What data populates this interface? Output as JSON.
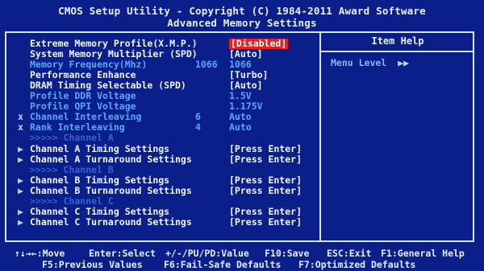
{
  "header": {
    "title": "CMOS Setup Utility - Copyright (C) 1984-2011 Award Software",
    "subtitle": "Advanced Memory Settings"
  },
  "help": {
    "title": "Item Help",
    "menu_level_label": "Menu Level",
    "menu_level_arrows": "▶▶"
  },
  "settings": [
    {
      "mark": "",
      "label": "Extreme Memory Profile(X.M.P.)",
      "num": "",
      "value": "[Disabled]",
      "style": "normal",
      "selected": true
    },
    {
      "mark": "",
      "label": "System Memory Multiplier (SPD)",
      "num": "",
      "value": "[Auto]",
      "style": "normal"
    },
    {
      "mark": "",
      "label": "Memory Frequency(Mhz)",
      "num": "1066",
      "value": "1066",
      "style": "dim"
    },
    {
      "mark": "",
      "label": "Performance Enhance",
      "num": "",
      "value": "[Turbo]",
      "style": "normal"
    },
    {
      "mark": "",
      "label": "DRAM Timing Selectable (SPD)",
      "num": "",
      "value": "[Auto]",
      "style": "normal"
    },
    {
      "mark": "",
      "label": "Profile DDR Voltage",
      "num": "",
      "value": "1.5V",
      "style": "dim"
    },
    {
      "mark": "",
      "label": "Profile QPI Voltage",
      "num": "",
      "value": "1.175V",
      "style": "dim"
    },
    {
      "mark": "x",
      "label": "Channel Interleaving",
      "num": "6",
      "value": "Auto",
      "style": "dim"
    },
    {
      "mark": "x",
      "label": "Rank Interleaving",
      "num": "4",
      "value": "Auto",
      "style": "dim"
    },
    {
      "mark": "",
      "label": ">>>>> Channel A",
      "num": "",
      "value": "",
      "style": "section"
    },
    {
      "mark": "▶",
      "label": "Channel A Timing Settings",
      "num": "",
      "value": "[Press Enter]",
      "style": "normal"
    },
    {
      "mark": "▶",
      "label": "Channel A Turnaround Settings",
      "num": "",
      "value": "[Press Enter]",
      "style": "normal"
    },
    {
      "mark": "",
      "label": ">>>>> Channel B",
      "num": "",
      "value": "",
      "style": "section"
    },
    {
      "mark": "▶",
      "label": "Channel B Timing Settings",
      "num": "",
      "value": "[Press Enter]",
      "style": "normal"
    },
    {
      "mark": "▶",
      "label": "Channel B Turnaround Settings",
      "num": "",
      "value": "[Press Enter]",
      "style": "normal"
    },
    {
      "mark": "",
      "label": ">>>>> Channel C",
      "num": "",
      "value": "",
      "style": "section"
    },
    {
      "mark": "▶",
      "label": "Channel C Timing Settings",
      "num": "",
      "value": "[Press Enter]",
      "style": "normal"
    },
    {
      "mark": "▶",
      "label": "Channel C Turnaround Settings",
      "num": "",
      "value": "[Press Enter]",
      "style": "normal"
    }
  ],
  "footer": {
    "move": "↑↓→←:Move",
    "select": "Enter:Select",
    "value": "+/-/PU/PD:Value",
    "save": "F10:Save",
    "exit": "ESC:Exit",
    "general_help": "F1:General Help",
    "previous_values": "F5:Previous Values",
    "fail_safe": "F6:Fail-Safe Defaults",
    "optimized": "F7:Optimized Defaults"
  },
  "colors": {
    "background": "#0b1f8a",
    "text": "#f2f6ff",
    "dim_text": "#58a6ff",
    "selection": "#e52020"
  }
}
